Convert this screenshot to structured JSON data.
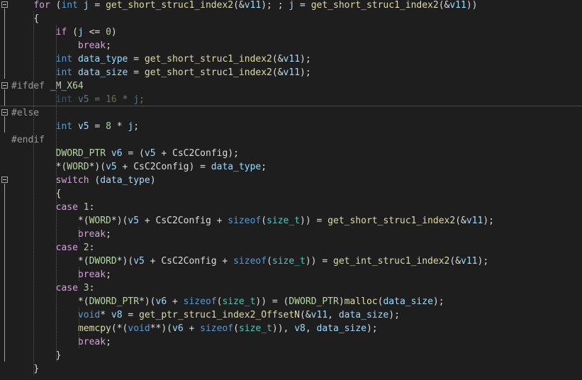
{
  "editor": {
    "background": "#1e1e1e",
    "lines": [
      {
        "indent": "    ",
        "tokens": [
          [
            "for",
            "ctl"
          ],
          [
            " (",
            ""
          ],
          [
            "int",
            "kw"
          ],
          [
            " ",
            ""
          ],
          [
            "j",
            "var"
          ],
          [
            " = ",
            ""
          ],
          [
            "get_short_struc1_index2",
            "fn"
          ],
          [
            "(&",
            ""
          ],
          [
            "v11",
            "var"
          ],
          [
            "); ; ",
            ""
          ],
          [
            "j",
            "var"
          ],
          [
            " = ",
            ""
          ],
          [
            "get_short_struc1_index2",
            "fn"
          ],
          [
            "(&",
            ""
          ],
          [
            "v11",
            "var"
          ],
          [
            "))",
            ""
          ]
        ]
      },
      {
        "indent": "    ",
        "tokens": [
          [
            "{",
            ""
          ]
        ]
      },
      {
        "indent": "        ",
        "tokens": [
          [
            "if",
            "ctl"
          ],
          [
            " (",
            ""
          ],
          [
            "j",
            "var"
          ],
          [
            " <= ",
            ""
          ],
          [
            "0",
            "num"
          ],
          [
            ")",
            ""
          ]
        ]
      },
      {
        "indent": "            ",
        "tokens": [
          [
            "break",
            "ctl"
          ],
          [
            ";",
            ""
          ]
        ]
      },
      {
        "indent": "        ",
        "tokens": [
          [
            "int",
            "kw"
          ],
          [
            " ",
            ""
          ],
          [
            "data_type",
            "var"
          ],
          [
            " = ",
            ""
          ],
          [
            "get_short_struc1_index2",
            "fn"
          ],
          [
            "(&",
            ""
          ],
          [
            "v11",
            "var"
          ],
          [
            ");",
            ""
          ]
        ]
      },
      {
        "indent": "        ",
        "tokens": [
          [
            "int",
            "kw"
          ],
          [
            " ",
            ""
          ],
          [
            "data_size",
            "var"
          ],
          [
            " = ",
            ""
          ],
          [
            "get_short_struc1_index2",
            "fn"
          ],
          [
            "(&",
            ""
          ],
          [
            "v11",
            "var"
          ],
          [
            ");",
            ""
          ]
        ]
      },
      {
        "indent": "",
        "tokens": [
          [
            "#ifdef",
            "pp"
          ],
          [
            " ",
            ""
          ],
          [
            "_M_X64",
            "mac"
          ]
        ]
      },
      {
        "indent": "        ",
        "dim": true,
        "tokens": [
          [
            "int",
            "kw"
          ],
          [
            " ",
            ""
          ],
          [
            "v5",
            "var"
          ],
          [
            " = ",
            ""
          ],
          [
            "16",
            "num"
          ],
          [
            " * ",
            ""
          ],
          [
            "j",
            "var"
          ],
          [
            ";",
            ""
          ]
        ]
      },
      {
        "indent": "",
        "tokens": [
          [
            "#else",
            "pp"
          ]
        ]
      },
      {
        "indent": "        ",
        "tokens": [
          [
            "int",
            "kw"
          ],
          [
            " ",
            ""
          ],
          [
            "v5",
            "var"
          ],
          [
            " = ",
            ""
          ],
          [
            "8",
            "num"
          ],
          [
            " * ",
            ""
          ],
          [
            "j",
            "var"
          ],
          [
            ";",
            ""
          ]
        ]
      },
      {
        "indent": "",
        "tokens": [
          [
            "#endif",
            "pp"
          ]
        ]
      },
      {
        "indent": "        ",
        "tokens": [
          [
            "DWORD_PTR",
            "mac"
          ],
          [
            " ",
            ""
          ],
          [
            "v6",
            "var"
          ],
          [
            " = (",
            ""
          ],
          [
            "v5",
            "var"
          ],
          [
            " + CsC2Config);",
            ""
          ]
        ]
      },
      {
        "indent": "        ",
        "tokens": [
          [
            "*(",
            ""
          ],
          [
            "WORD",
            "mac"
          ],
          [
            "*)(",
            ""
          ],
          [
            "v5",
            "var"
          ],
          [
            " + CsC2Config) = ",
            ""
          ],
          [
            "data_type",
            "var"
          ],
          [
            ";",
            ""
          ]
        ]
      },
      {
        "indent": "        ",
        "tokens": [
          [
            "switch",
            "ctl"
          ],
          [
            " (",
            ""
          ],
          [
            "data_type",
            "var"
          ],
          [
            ")",
            ""
          ]
        ]
      },
      {
        "indent": "        ",
        "tokens": [
          [
            "{",
            ""
          ]
        ]
      },
      {
        "indent": "        ",
        "tokens": [
          [
            "case",
            "ctl"
          ],
          [
            " ",
            ""
          ],
          [
            "1",
            "num"
          ],
          [
            ":",
            ""
          ]
        ]
      },
      {
        "indent": "            ",
        "tokens": [
          [
            "*(",
            ""
          ],
          [
            "WORD",
            "mac"
          ],
          [
            "*)(",
            ""
          ],
          [
            "v5",
            "var"
          ],
          [
            " + CsC2Config + ",
            ""
          ],
          [
            "sizeof",
            "kw"
          ],
          [
            "(",
            ""
          ],
          [
            "size_t",
            "ty"
          ],
          [
            ")) = ",
            ""
          ],
          [
            "get_short_struc1_index2",
            "fn"
          ],
          [
            "(&",
            ""
          ],
          [
            "v11",
            "var"
          ],
          [
            ");",
            ""
          ]
        ]
      },
      {
        "indent": "            ",
        "tokens": [
          [
            "break",
            "ctl"
          ],
          [
            ";",
            ""
          ]
        ]
      },
      {
        "indent": "        ",
        "tokens": [
          [
            "case",
            "ctl"
          ],
          [
            " ",
            ""
          ],
          [
            "2",
            "num"
          ],
          [
            ":",
            ""
          ]
        ]
      },
      {
        "indent": "            ",
        "tokens": [
          [
            "*(",
            ""
          ],
          [
            "DWORD",
            "mac"
          ],
          [
            "*)(",
            ""
          ],
          [
            "v5",
            "var"
          ],
          [
            " + CsC2Config + ",
            ""
          ],
          [
            "sizeof",
            "kw"
          ],
          [
            "(",
            ""
          ],
          [
            "size_t",
            "ty"
          ],
          [
            ")) = ",
            ""
          ],
          [
            "get_int_struc1_index2",
            "fn"
          ],
          [
            "(&",
            ""
          ],
          [
            "v11",
            "var"
          ],
          [
            ");",
            ""
          ]
        ]
      },
      {
        "indent": "            ",
        "tokens": [
          [
            "break",
            "ctl"
          ],
          [
            ";",
            ""
          ]
        ]
      },
      {
        "indent": "        ",
        "tokens": [
          [
            "case",
            "ctl"
          ],
          [
            " ",
            ""
          ],
          [
            "3",
            "num"
          ],
          [
            ":",
            ""
          ]
        ]
      },
      {
        "indent": "            ",
        "tokens": [
          [
            "*(",
            ""
          ],
          [
            "DWORD_PTR",
            "mac"
          ],
          [
            "*)(",
            ""
          ],
          [
            "v6",
            "var"
          ],
          [
            " + ",
            ""
          ],
          [
            "sizeof",
            "kw"
          ],
          [
            "(",
            ""
          ],
          [
            "size_t",
            "ty"
          ],
          [
            ")) = (",
            ""
          ],
          [
            "DWORD_PTR",
            "mac"
          ],
          [
            ")",
            ""
          ],
          [
            "malloc",
            "fn"
          ],
          [
            "(",
            ""
          ],
          [
            "data_size",
            "var"
          ],
          [
            ");",
            ""
          ]
        ]
      },
      {
        "indent": "            ",
        "tokens": [
          [
            "void",
            "kw"
          ],
          [
            "* ",
            ""
          ],
          [
            "v8",
            "var"
          ],
          [
            " = ",
            ""
          ],
          [
            "get_ptr_struc1_index2_OffsetN",
            "fn"
          ],
          [
            "(&",
            ""
          ],
          [
            "v11",
            "var"
          ],
          [
            ", ",
            ""
          ],
          [
            "data_size",
            "var"
          ],
          [
            ");",
            ""
          ]
        ]
      },
      {
        "indent": "            ",
        "tokens": [
          [
            "memcpy",
            "fn"
          ],
          [
            "(*(",
            ""
          ],
          [
            "void",
            "kw"
          ],
          [
            "**)(",
            ""
          ],
          [
            "v6",
            "var"
          ],
          [
            " + ",
            ""
          ],
          [
            "sizeof",
            "kw"
          ],
          [
            "(",
            ""
          ],
          [
            "size_t",
            "ty"
          ],
          [
            ")), ",
            ""
          ],
          [
            "v8",
            "var"
          ],
          [
            ", ",
            ""
          ],
          [
            "data_size",
            "var"
          ],
          [
            ");",
            ""
          ]
        ]
      },
      {
        "indent": "            ",
        "tokens": [
          [
            "break",
            "ctl"
          ],
          [
            ";",
            ""
          ]
        ]
      },
      {
        "indent": "        ",
        "tokens": [
          [
            "}",
            ""
          ]
        ]
      },
      {
        "indent": "    ",
        "tokens": [
          [
            "}",
            ""
          ]
        ]
      }
    ]
  }
}
